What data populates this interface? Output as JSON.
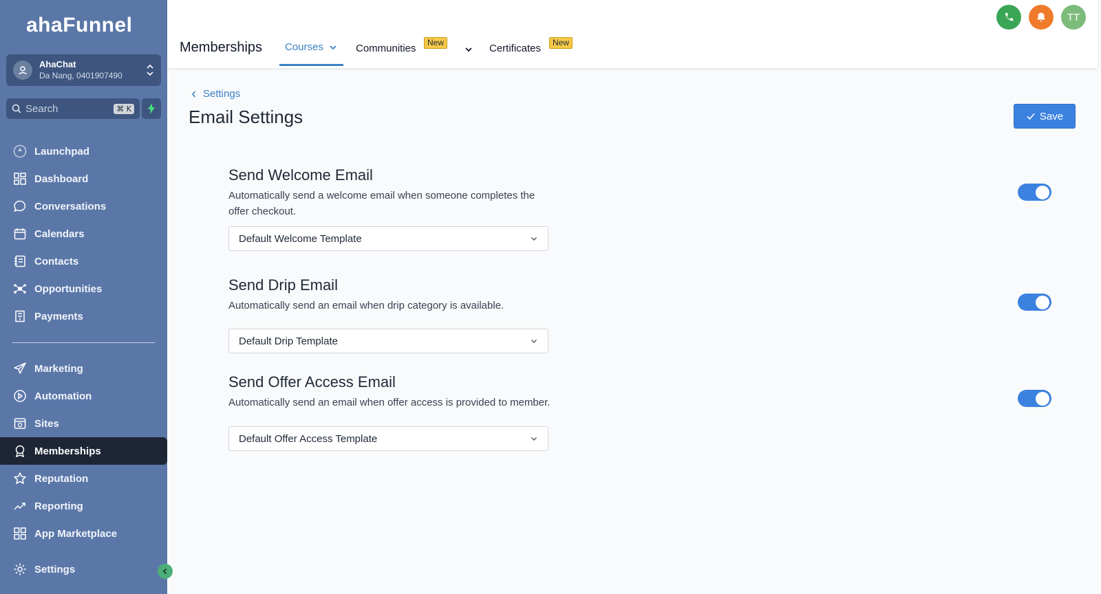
{
  "brand": {
    "logo_text": "ahaFunnel"
  },
  "account": {
    "name": "AhaChat",
    "location": "Da Nang, 0401907490"
  },
  "search": {
    "placeholder": "Search",
    "shortcut": "⌘ K"
  },
  "sidebar": {
    "items": [
      {
        "label": "Launchpad",
        "icon": "rocket-icon"
      },
      {
        "label": "Dashboard",
        "icon": "grid-icon"
      },
      {
        "label": "Conversations",
        "icon": "chat-icon"
      },
      {
        "label": "Calendars",
        "icon": "calendar-icon"
      },
      {
        "label": "Contacts",
        "icon": "contacts-icon"
      },
      {
        "label": "Opportunities",
        "icon": "network-icon"
      },
      {
        "label": "Payments",
        "icon": "receipt-icon"
      },
      {
        "label": "Marketing",
        "icon": "send-icon"
      },
      {
        "label": "Automation",
        "icon": "play-circle-icon"
      },
      {
        "label": "Sites",
        "icon": "globe-icon"
      },
      {
        "label": "Memberships",
        "icon": "badge-icon",
        "active": true
      },
      {
        "label": "Reputation",
        "icon": "star-icon"
      },
      {
        "label": "Reporting",
        "icon": "trend-icon"
      },
      {
        "label": "App Marketplace",
        "icon": "apps-icon"
      },
      {
        "label": "Settings",
        "icon": "gear-icon"
      }
    ]
  },
  "topbar": {
    "title": "Memberships",
    "tabs": [
      {
        "label": "Courses",
        "active": true
      },
      {
        "label": "Communities",
        "badge": "New"
      },
      {
        "label": "Certificates",
        "badge": "New"
      }
    ],
    "avatar_initials": "TT"
  },
  "colors": {
    "accent": "#3b82e0",
    "sidebar": "#5b77a8",
    "phone": "#3aa655",
    "bell": "#f07a2b",
    "avatar": "#7dbb7a"
  },
  "page": {
    "breadcrumb": "Settings",
    "title": "Email Settings",
    "save_label": "Save"
  },
  "sections": [
    {
      "title": "Send Welcome Email",
      "desc": "Automatically send a welcome email when someone completes the offer checkout.",
      "template": "Default Welcome Template",
      "enabled": true
    },
    {
      "title": "Send Drip Email",
      "desc": "Automatically send an email when drip category is available.",
      "template": "Default Drip Template",
      "enabled": true
    },
    {
      "title": "Send Offer Access Email",
      "desc": "Automatically send an email when offer access is provided to member.",
      "template": "Default Offer Access Template",
      "enabled": true
    }
  ]
}
